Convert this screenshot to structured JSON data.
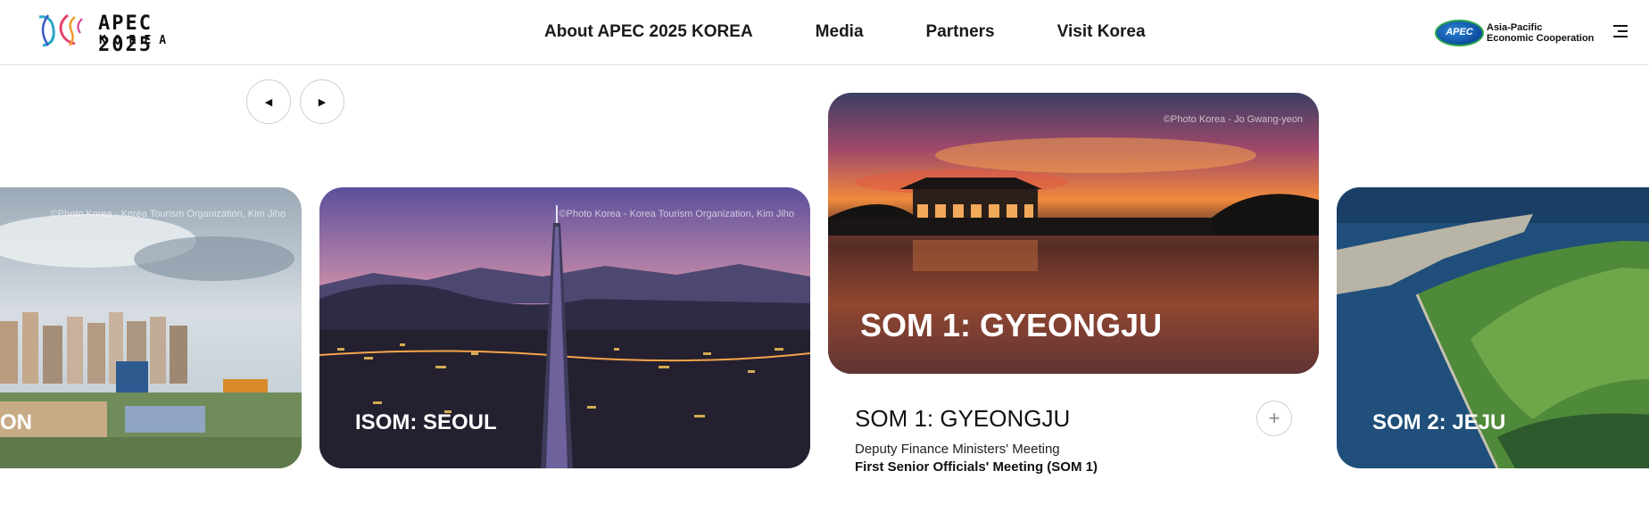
{
  "header": {
    "logo_title": "APEC 2025",
    "logo_sub": "KOREA",
    "nav": [
      "About APEC 2025 KOREA",
      "Media",
      "Partners",
      "Visit Korea"
    ],
    "apec_badge": "APEC",
    "apec_name_line1": "Asia-Pacific",
    "apec_name_line2": "Economic Cooperation"
  },
  "carousel": {
    "prev_icon": "◀",
    "next_icon": "▶",
    "cards": [
      {
        "title": "ON",
        "credit": "©Photo Korea - Korea Tourism Organization, Kim Jiho"
      },
      {
        "title": "ISOM: SEOUL",
        "credit": "©Photo Korea - Korea Tourism Organization, Kim Jiho"
      },
      {
        "title": "SOM 1: GYEONGJU",
        "credit": "©Photo Korea - Jo Gwang-yeon"
      },
      {
        "title": "SOM 2: JEJU",
        "credit": ""
      }
    ],
    "active": {
      "title": "SOM 1: GYEONGJU",
      "line1": "Deputy Finance Ministers' Meeting",
      "line2": "First Senior Officials' Meeting (SOM 1)",
      "plus": "+"
    }
  },
  "colors": {
    "accent": "#1a56b0",
    "border": "#cfcfcf"
  }
}
